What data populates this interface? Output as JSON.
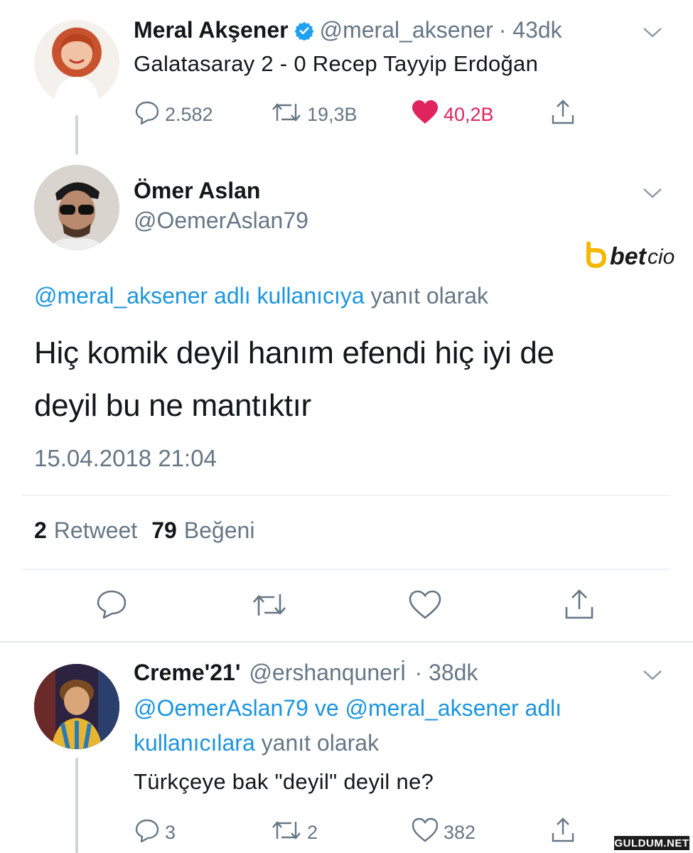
{
  "tweet1": {
    "name": "Meral Akşener",
    "handle": "@meral_aksener",
    "time": "· 43dk",
    "text": "Galatasaray 2 - 0 Recep Tayyip Erdoğan",
    "replies": "2.582",
    "retweets": "19,3B",
    "likes": "40,2B",
    "like_color": "#e0245e"
  },
  "tweet2": {
    "name": "Ömer Aslan",
    "handle": "@OemerAslan79",
    "reply_to_handle": "@meral_aksener adlı kullanıcıya",
    "reply_suffix": "yanıt olarak",
    "text_line1": "Hiç komik deyil hanım efendi hiç iyi de",
    "text_line2": "deyil bu ne mantıktır",
    "timestamp": "15.04.2018 21:04",
    "retweet_count": "2",
    "retweet_label": "Retweet",
    "like_count": "79",
    "like_label": "Beğeni"
  },
  "tweet3": {
    "name": "Creme'21'",
    "handle": "@ershanqunerİ",
    "time": "· 38dk",
    "reply_line1": "@OemerAslan79 ve @meral_aksener adlı",
    "reply_line2_blue": "kullanıcılara",
    "reply_suffix": "yanıt olarak",
    "text": "Türkçeye bak \"deyil\" deyil ne?",
    "replies": "3",
    "retweets": "2",
    "likes": "382"
  },
  "watermark": {
    "brand_bold": "bet",
    "brand_light": "cio",
    "site": "GULDUM.NET"
  },
  "colors": {
    "accent_blue": "#1b95e0",
    "text_gray": "#657786",
    "verified_blue": "#1da1f2",
    "brand_yellow": "#f5b800"
  }
}
